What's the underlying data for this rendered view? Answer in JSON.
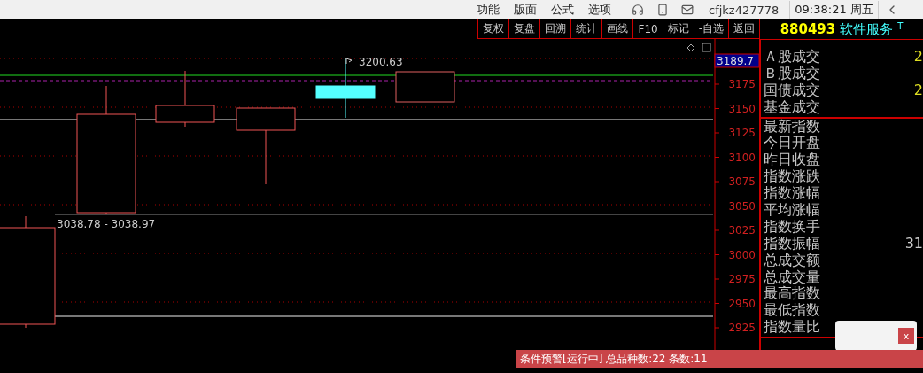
{
  "menu": [
    "功能",
    "版面",
    "公式",
    "选项"
  ],
  "user": "cfjkz427778",
  "clock": "09:38:21 周五",
  "toolbar": [
    "复权",
    "复盘",
    "回溯",
    "统计",
    "画线",
    "F10",
    "标记",
    "-自选",
    "返回"
  ],
  "chart": {
    "high_label": "3200.63",
    "range_label": "3038.78 - 3038.97",
    "price_tag": "3189.7",
    "axis": [
      "3175",
      "3150",
      "3125",
      "3100",
      "3075",
      "3050",
      "3025",
      "3000",
      "2975",
      "2950",
      "2925"
    ]
  },
  "panel": {
    "code": "880493",
    "name": "软件服务",
    "marker": "T",
    "groups": [
      [
        {
          "label": "Ａ股成交",
          "value": "2"
        },
        {
          "label": "Ｂ股成交"
        },
        {
          "label": "国债成交",
          "value": "2"
        },
        {
          "label": "基金成交"
        }
      ],
      [
        {
          "label": "最新指数"
        },
        {
          "label": "今日开盘"
        },
        {
          "label": "昨日收盘"
        },
        {
          "label": "指数涨跌"
        },
        {
          "label": "指数涨幅"
        },
        {
          "label": "平均涨幅"
        },
        {
          "label": "指数换手"
        },
        {
          "label": "指数振幅",
          "value": "31"
        },
        {
          "label": "总成交额"
        },
        {
          "label": "总成交量"
        },
        {
          "label": "最高指数"
        },
        {
          "label": "最低指数"
        },
        {
          "label": "指数量比"
        }
      ]
    ]
  },
  "popup": {
    "close": "x"
  },
  "alert": {
    "text": "条件预警[运行中] 总品种数:22 条数:11"
  }
}
